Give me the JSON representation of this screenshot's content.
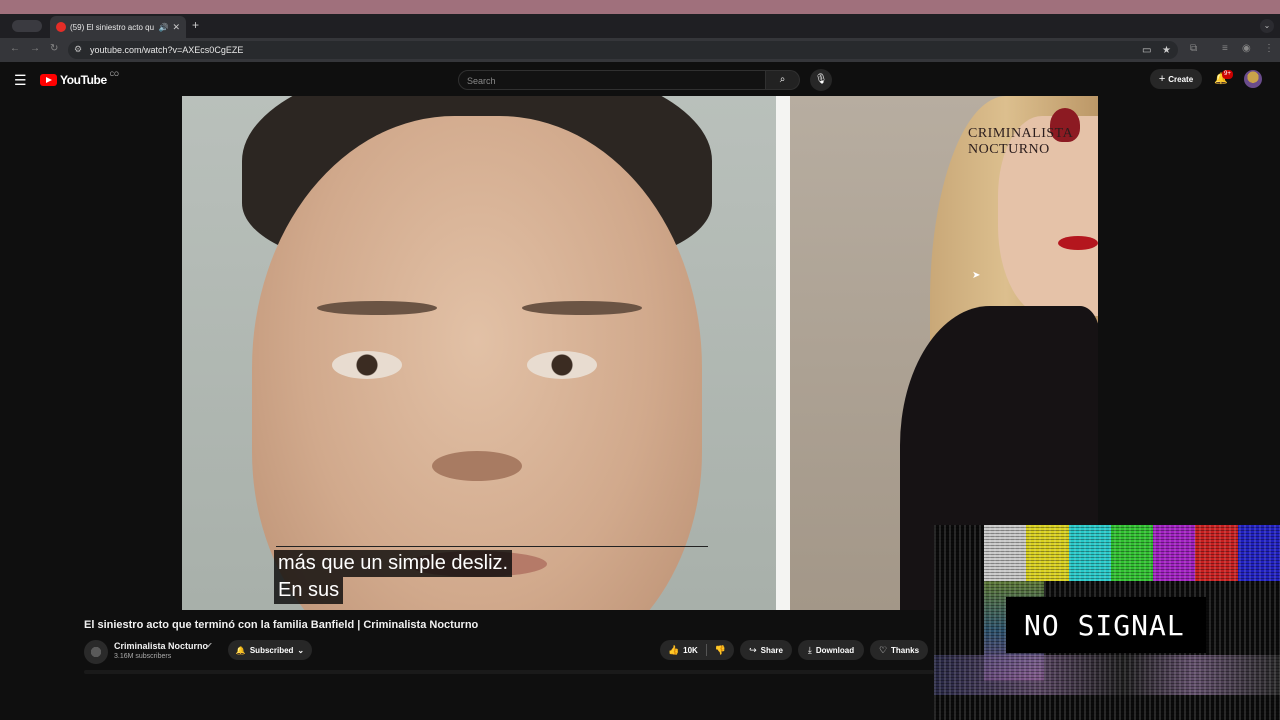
{
  "browser": {
    "tab_title": "(59) El siniestro acto que terminó con la familia Banfield | Criminalista Nocturno",
    "url": "youtube.com/watch?v=AXEcs0CgEZE"
  },
  "youtube": {
    "logo_text": "YouTube",
    "logo_suffix": "CO",
    "search_placeholder": "Search",
    "create_label": "Create",
    "notification_count": "9+"
  },
  "video": {
    "watermark": "CRIMINALISTA NOCTURNO",
    "caption_line1": "más que un simple desliz.",
    "caption_line2": "En sus",
    "title": "El siniestro acto que terminó con la familia Banfield | Criminalista Nocturno"
  },
  "channel": {
    "name": "Criminalista Nocturno",
    "subscribers": "3.16M subscribers",
    "subscribed_label": "Subscribed"
  },
  "actions": {
    "likes": "10K",
    "share_label": "Share",
    "download_label": "Download",
    "thanks_label": "Thanks"
  },
  "overlay": {
    "text": "NO SIGNAL",
    "bar_colors": [
      "#c8c8c8",
      "#d8d020",
      "#28c8c8",
      "#30c030",
      "#a020c0",
      "#c82020",
      "#2020c0"
    ]
  }
}
